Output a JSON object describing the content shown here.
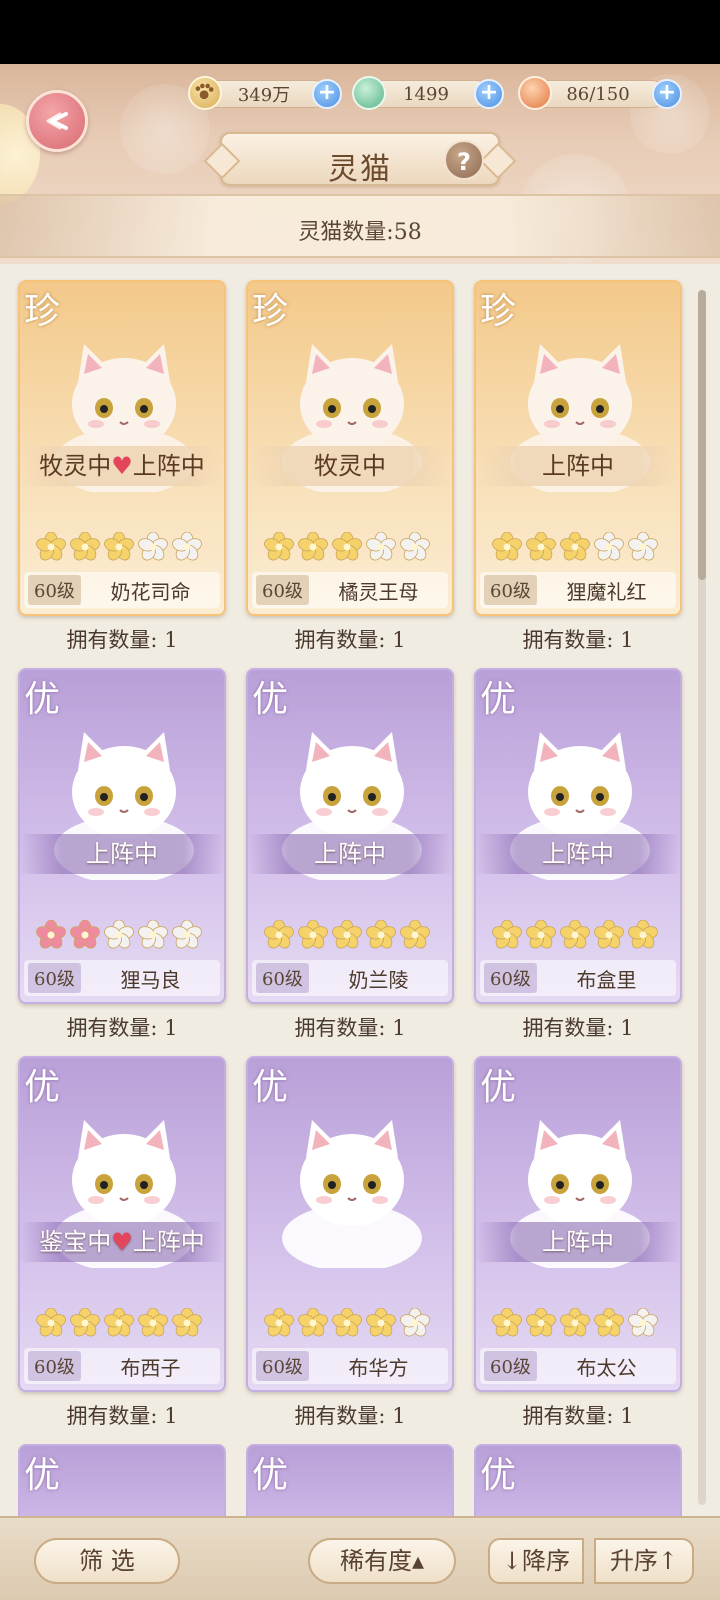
{
  "header": {
    "title": "灵猫",
    "count_label": "灵猫数量:58",
    "resources": [
      {
        "icon": "paw-coin-icon",
        "value": "349万"
      },
      {
        "icon": "jade-icon",
        "value": "1499"
      },
      {
        "icon": "food-bowl-icon",
        "value": "86/150"
      }
    ]
  },
  "cards": [
    {
      "rarity": "珍",
      "tier": "gold",
      "status": "牧灵中♥上阵中",
      "level": "60级",
      "name": "奶花司命",
      "stars_filled": 3,
      "stars_total": 5,
      "star_color": "#f5d36a",
      "owned": "拥有数量: 1"
    },
    {
      "rarity": "珍",
      "tier": "gold",
      "status": "牧灵中",
      "level": "60级",
      "name": "橘灵王母",
      "stars_filled": 3,
      "stars_total": 5,
      "star_color": "#f5d36a",
      "owned": "拥有数量: 1"
    },
    {
      "rarity": "珍",
      "tier": "gold",
      "status": "上阵中",
      "level": "60级",
      "name": "狸魔礼红",
      "stars_filled": 3,
      "stars_total": 5,
      "star_color": "#f5d36a",
      "owned": "拥有数量: 1"
    },
    {
      "rarity": "优",
      "tier": "purple",
      "status": "上阵中",
      "level": "60级",
      "name": "狸马良",
      "stars_filled": 2,
      "stars_total": 5,
      "star_color": "#f08aa0",
      "owned": "拥有数量: 1"
    },
    {
      "rarity": "优",
      "tier": "purple",
      "status": "上阵中",
      "level": "60级",
      "name": "奶兰陵",
      "stars_filled": 5,
      "stars_total": 5,
      "star_color": "#f5d36a",
      "owned": "拥有数量: 1"
    },
    {
      "rarity": "优",
      "tier": "purple",
      "status": "上阵中",
      "level": "60级",
      "name": "布盒里",
      "stars_filled": 5,
      "stars_total": 5,
      "star_color": "#f5d36a",
      "owned": "拥有数量: 1"
    },
    {
      "rarity": "优",
      "tier": "purple",
      "status": "鉴宝中♥上阵中",
      "level": "60级",
      "name": "布西子",
      "stars_filled": 5,
      "stars_total": 5,
      "star_color": "#f5d36a",
      "owned": "拥有数量: 1"
    },
    {
      "rarity": "优",
      "tier": "purple",
      "status": "",
      "level": "60级",
      "name": "布华方",
      "stars_filled": 4,
      "stars_total": 5,
      "star_color": "#f5d36a",
      "owned": "拥有数量: 1"
    },
    {
      "rarity": "优",
      "tier": "purple",
      "status": "上阵中",
      "level": "60级",
      "name": "布太公",
      "stars_filled": 4,
      "stars_total": 5,
      "star_color": "#f5d36a",
      "owned": "拥有数量: 1"
    }
  ],
  "partial_cards": [
    {
      "rarity": "优"
    },
    {
      "rarity": "优"
    },
    {
      "rarity": "优"
    }
  ],
  "footer": {
    "filter_label": "筛 选",
    "rarity_sort_label": "稀有度▴",
    "desc_label": "↓降序",
    "asc_label": "升序↑"
  },
  "colors": {
    "gold_card": "#f3c98a",
    "purple_card": "#b9a0d8",
    "star_empty": "#f4f2f0",
    "heart": "#e4455a"
  }
}
